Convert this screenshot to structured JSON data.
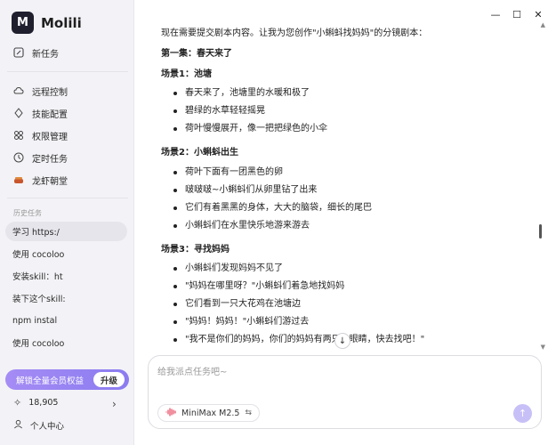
{
  "app": {
    "name": "Molili",
    "logo_text": "M"
  },
  "sidebar": {
    "new_task": "新任务",
    "items": [
      {
        "label": "远程控制",
        "icon": "cloud-icon"
      },
      {
        "label": "技能配置",
        "icon": "diamond-icon"
      },
      {
        "label": "权限管理",
        "icon": "grid-icon"
      },
      {
        "label": "定时任务",
        "icon": "clock-icon"
      },
      {
        "label": "龙虾朝堂",
        "icon": "lobster-icon"
      }
    ],
    "history_label": "历史任务",
    "history": [
      {
        "label": "学习 https:/",
        "active": true
      },
      {
        "label": "使用 cocoloo",
        "active": false
      },
      {
        "label": "安装skill：ht",
        "active": false
      },
      {
        "label": "装下这个skill:",
        "active": false
      },
      {
        "label": "npm instal",
        "active": false
      },
      {
        "label": "使用 cocoloo",
        "active": false
      }
    ],
    "vip_text": "解锁全量会员权益",
    "vip_button": "升级",
    "points": "18,905",
    "user_center": "个人中心"
  },
  "chat": {
    "lines": [
      {
        "text": "现在需要提交剧本内容。让我为您创作\"小蝌蚪找妈妈\"的分镜剧本：",
        "type": "p"
      },
      {
        "text": "第一集：春天来了",
        "type": "h"
      },
      {
        "text": "场景1：池塘",
        "type": "h"
      },
      {
        "text": "春天来了，池塘里的水暖和极了",
        "type": "li"
      },
      {
        "text": "碧绿的水草轻轻摇晃",
        "type": "li"
      },
      {
        "text": "荷叶慢慢展开，像一把把绿色的小伞",
        "type": "li"
      },
      {
        "text": "场景2：小蝌蚪出生",
        "type": "h"
      },
      {
        "text": "荷叶下面有一团黑色的卵",
        "type": "li"
      },
      {
        "text": "啵啵啵~小蝌蚪们从卵里钻了出来",
        "type": "li"
      },
      {
        "text": "它们有着黑黑的身体，大大的脑袋，细长的尾巴",
        "type": "li"
      },
      {
        "text": "小蝌蚪们在水里快乐地游来游去",
        "type": "li"
      },
      {
        "text": "场景3：寻找妈妈",
        "type": "h"
      },
      {
        "text": "小蝌蚪们发现妈妈不见了",
        "type": "li"
      },
      {
        "text": "\"妈妈在哪里呀？\"小蝌蚪们着急地找妈妈",
        "type": "li"
      },
      {
        "text": "它们看到一只大花鸡在池塘边",
        "type": "li"
      },
      {
        "text": "\"妈妈！妈妈！\"小蝌蚪们游过去",
        "type": "li"
      },
      {
        "text": "\"我不是你们的妈妈，你们的妈妈有两只大眼睛，快去找吧！\"",
        "type": "li"
      }
    ]
  },
  "input": {
    "placeholder": "给我派点任务吧~",
    "value": ""
  },
  "model": {
    "name": "MiniMax M2.5"
  },
  "colors": {
    "accent": "#8b7cf0",
    "send": "#c7c0f7"
  }
}
